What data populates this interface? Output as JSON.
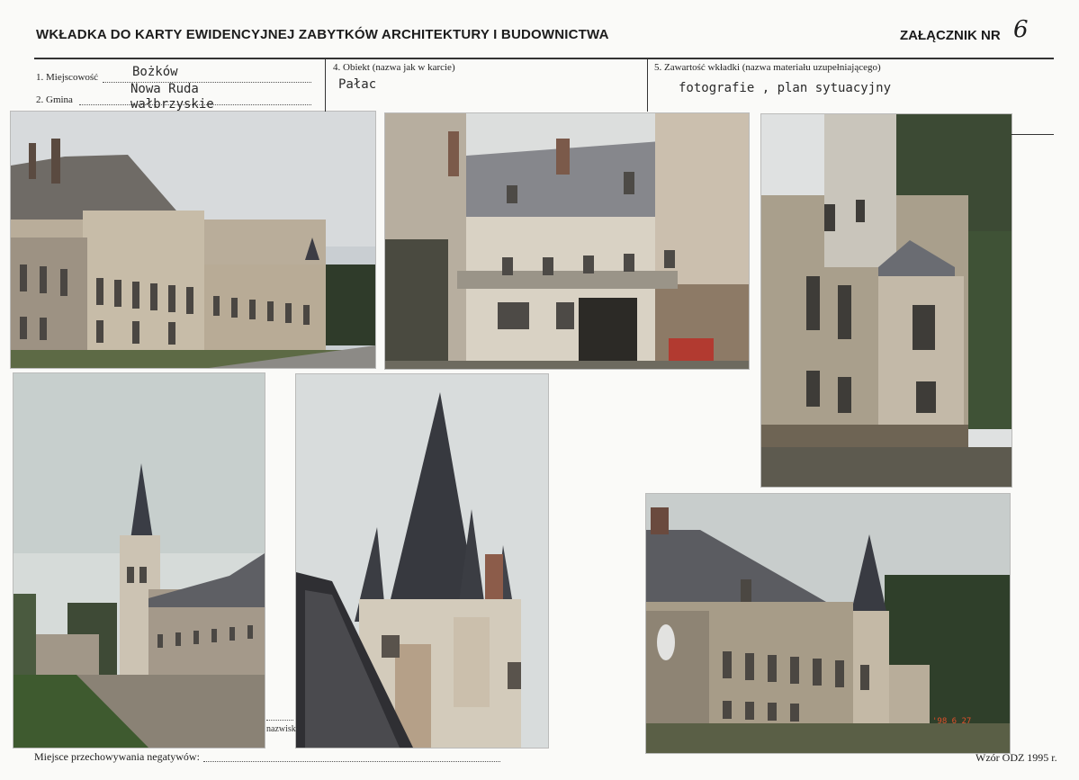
{
  "header": {
    "title": "WKŁADKA DO KARTY EWIDENCYJNEJ ZABYTKÓW ARCHITEKTURY I BUDOWNICTWA",
    "annex_label": "ZAŁĄCZNIK NR",
    "annex_number": "6"
  },
  "fields": {
    "locality_label": "1. Miejscowość",
    "locality_value": "Bożków",
    "commune_label": "2. Gmina",
    "commune_value": "Nowa Ruda",
    "voivodeship_value": "wałbrzyskie",
    "object_label": "4. Obiekt (nazwa jak w karcie)",
    "object_value": "Pałac",
    "contents_label": "5. Zawartość wkładki (nazwa materiału uzupełniającego)",
    "contents_value": "fotografie , plan sytuacyjny"
  },
  "photos": [
    {
      "name": "photo-palace-long-facade",
      "icon": "photo-icon"
    },
    {
      "name": "photo-palace-courtyard",
      "icon": "photo-icon"
    },
    {
      "name": "photo-palace-corner-tower",
      "icon": "photo-icon"
    },
    {
      "name": "photo-palace-tower-distant",
      "icon": "photo-icon"
    },
    {
      "name": "photo-palace-spire-closeup",
      "icon": "photo-icon"
    },
    {
      "name": "photo-palace-side-wing",
      "icon": "photo-icon"
    }
  ],
  "photo_stamp": "'98 6 27",
  "edge_fragment": "nazwisk",
  "footer": {
    "negatives_label": "Miejsce przechowywania negatywów:",
    "model_label": "Wzór ODZ 1995 r."
  },
  "colors": {
    "ink": "#1c1c1c",
    "paper": "#fafaf8",
    "stamp": "#e0502a"
  }
}
